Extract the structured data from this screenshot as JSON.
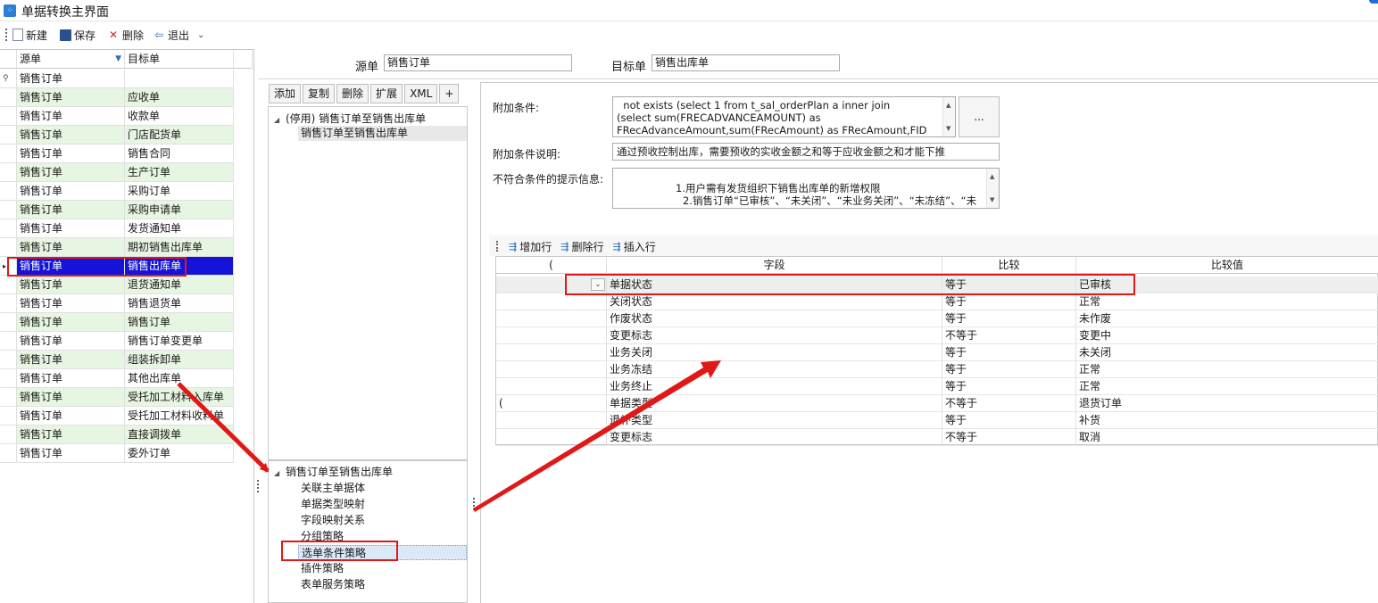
{
  "window": {
    "title": "单据转换主界面"
  },
  "toolbar": {
    "new_label": "新建",
    "save_label": "保存",
    "delete_label": "删除",
    "exit_label": "退出"
  },
  "left_grid": {
    "headers": [
      "源单",
      "目标单"
    ],
    "filter_row": [
      "销售订单",
      ""
    ],
    "rows": [
      [
        "销售订单",
        "应收单"
      ],
      [
        "销售订单",
        "收款单"
      ],
      [
        "销售订单",
        "门店配货单"
      ],
      [
        "销售订单",
        "销售合同"
      ],
      [
        "销售订单",
        "生产订单"
      ],
      [
        "销售订单",
        "采购订单"
      ],
      [
        "销售订单",
        "采购申请单"
      ],
      [
        "销售订单",
        "发货通知单"
      ],
      [
        "销售订单",
        "期初销售出库单"
      ],
      [
        "销售订单",
        "销售出库单"
      ],
      [
        "销售订单",
        "退货通知单"
      ],
      [
        "销售订单",
        "销售退货单"
      ],
      [
        "销售订单",
        "销售订单"
      ],
      [
        "销售订单",
        "销售订单变更单"
      ],
      [
        "销售订单",
        "组装拆卸单"
      ],
      [
        "销售订单",
        "其他出库单"
      ],
      [
        "销售订单",
        "受托加工材料入库单"
      ],
      [
        "销售订单",
        "受托加工材料收料单"
      ],
      [
        "销售订单",
        "直接调拨单"
      ],
      [
        "销售订单",
        "委外订单"
      ]
    ]
  },
  "header_fields": {
    "source_label": "源单",
    "source_value": "销售订单",
    "target_label": "目标单",
    "target_value": "销售出库单"
  },
  "mid_buttons": [
    "添加",
    "复制",
    "删除",
    "扩展",
    "XML",
    "+"
  ],
  "rule_tree": {
    "parent": "(停用) 销售订单至销售出库单",
    "child": "销售订单至销售出库单"
  },
  "strategy_tree": {
    "root": "销售订单至销售出库单",
    "items": [
      "关联主单据体",
      "单据类型映射",
      "字段映射关系",
      "分组策略",
      "选单条件策略",
      "插件策略",
      "表单服务策略"
    ]
  },
  "conditions": {
    "extra_label": "附加条件:",
    "extra_lines": [
      "  not exists (select 1 from t_sal_orderPlan a inner join",
      "(select sum(FRECADVANCEAMOUNT) as",
      "FRecAdvanceAmount,sum(FRecAmount) as FRecAmount,FID"
    ],
    "more_button": "...",
    "desc_label": "附加条件说明:",
    "desc_value": "通过预收控制出库，需要预收的实收金额之和等于应收金额之和才能下推",
    "msg_label": "不符合条件的提示信息:",
    "msg_lines": [
      "1.用户需有发货组织下销售出库单的新增权限",
      "2.销售订单“已审核”、“未关闭”、“未业务关闭”、“未冻结”、“未"
    ]
  },
  "cond_toolbar": {
    "add_row": "增加行",
    "delete_row": "删除行",
    "insert_row": "插入行"
  },
  "cond_grid": {
    "headers": [
      "(",
      "字段",
      "比较",
      "比较值"
    ],
    "rows": [
      [
        "",
        "单据状态",
        "等于",
        "已审核"
      ],
      [
        "",
        "关闭状态",
        "等于",
        "正常"
      ],
      [
        "",
        "作废状态",
        "等于",
        "未作废"
      ],
      [
        "",
        "变更标志",
        "不等于",
        "变更中"
      ],
      [
        "",
        "业务关闭",
        "等于",
        "未关闭"
      ],
      [
        "",
        "业务冻结",
        "等于",
        "正常"
      ],
      [
        "",
        "业务终止",
        "等于",
        "正常"
      ],
      [
        "(",
        "单据类型",
        "不等于",
        "退货订单"
      ],
      [
        "",
        "退补类型",
        "等于",
        "补货"
      ],
      [
        "",
        "变更标志",
        "不等于",
        "取消"
      ]
    ]
  },
  "colors": {
    "selection": "#1414d8",
    "row_green": "#e7f5e3",
    "annotation_red": "#e01818"
  }
}
